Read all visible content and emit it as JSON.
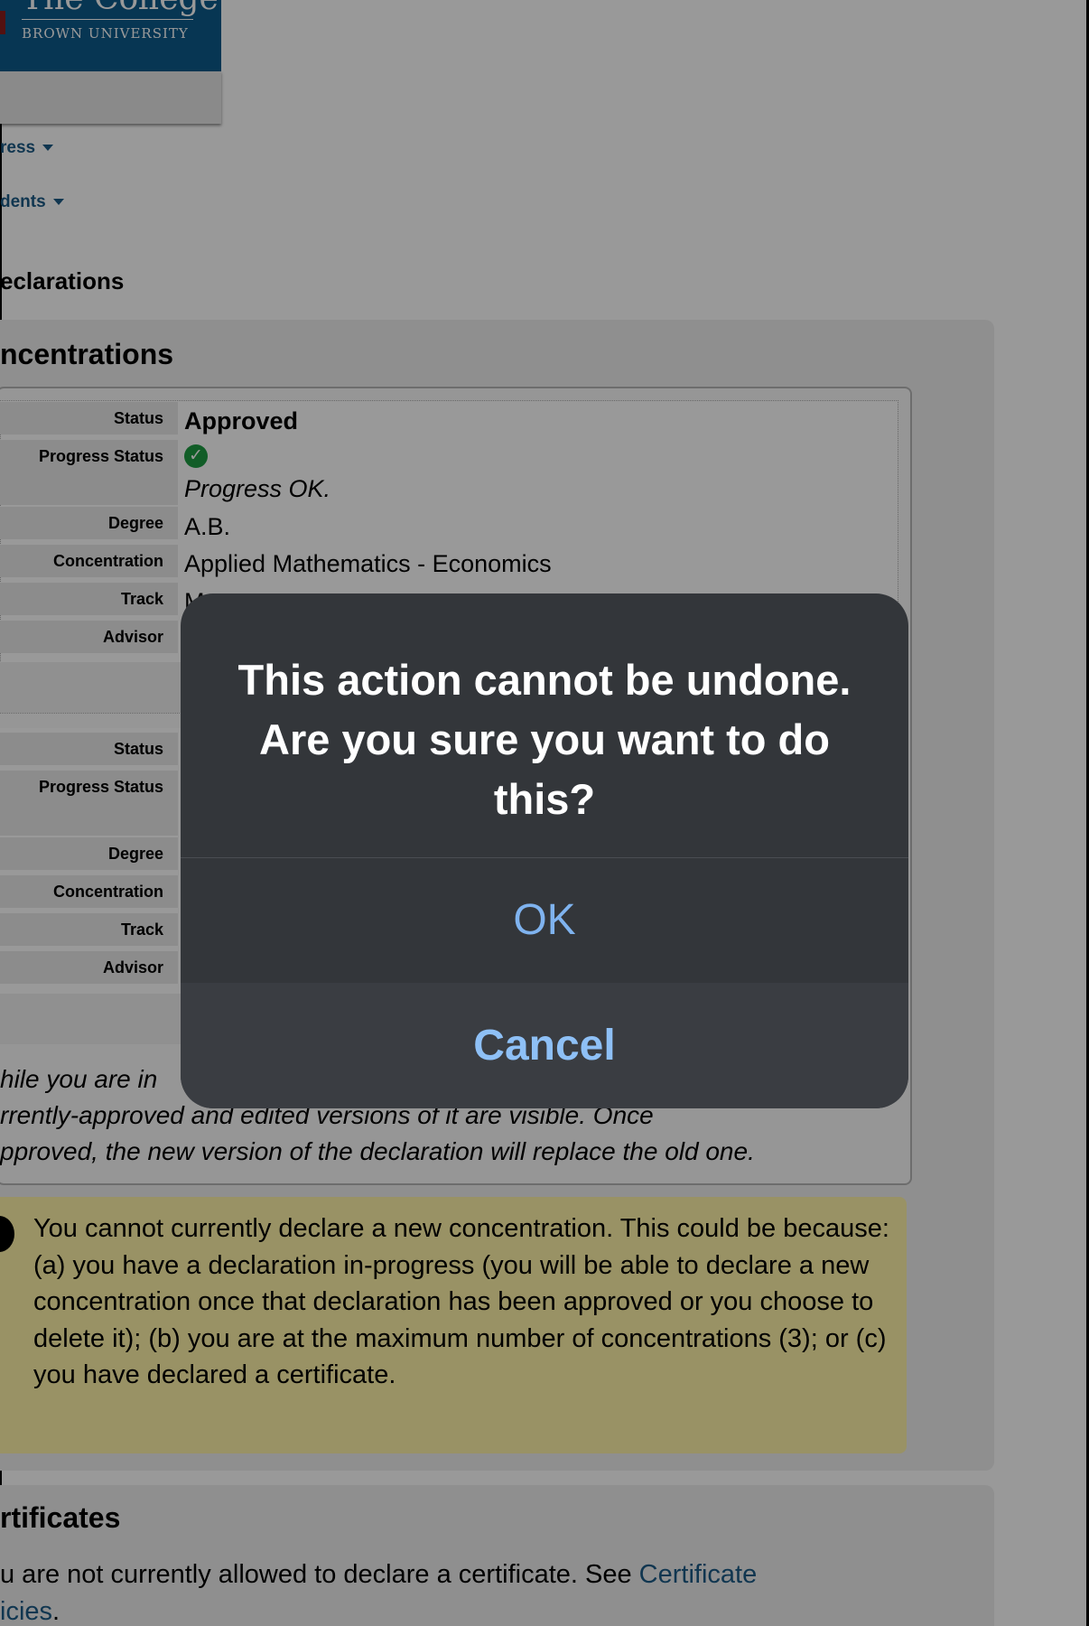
{
  "header": {
    "logo_title": "The College",
    "logo_subtitle": "BROWN UNIVERSITY"
  },
  "nav": {
    "item1": "ress",
    "item2": "dents"
  },
  "section_declarations": "eclarations",
  "section_concentrations": "ncentrations",
  "declaration1": {
    "labels": {
      "status": "Status",
      "progress_status": "Progress Status",
      "degree": "Degree",
      "concentration": "Concentration",
      "track": "Track",
      "advisor": "Advisor"
    },
    "status": "Approved",
    "progress_text": "Progress OK.",
    "degree": "A.B.",
    "concentration": "Applied Mathematics - Economics",
    "track_partial": "M"
  },
  "declaration2": {
    "labels": {
      "status": "Status",
      "progress_status": "Progress Status",
      "degree": "Degree",
      "concentration": "Concentration",
      "track": "Track",
      "advisor": "Advisor"
    }
  },
  "note": {
    "line1": "hile you are in",
    "line2": "rrently-approved and edited versions of it are visible. Once",
    "line3": "pproved, the new version of the declaration will replace the old one."
  },
  "warning": {
    "text": "You cannot currently declare a new concentration. This could be because: (a) you have a declaration in-progress (you will be able to declare a new concentration once that declaration has been approved or you choose to delete it); (b) you are at the maximum number of concentrations (3); or (c) you have declared a certificate."
  },
  "section_certificates": "rtificates",
  "certificates": {
    "text_before": "u are not currently allowed to declare a certificate. See ",
    "link1": "Certificate",
    "link2": "icies",
    "text_after": "."
  },
  "dialog": {
    "message": "This action cannot be undone. Are you sure you want to do this?",
    "ok_label": "OK",
    "cancel_label": "Cancel"
  },
  "colors": {
    "link": "#1c5a86",
    "warning_bg": "#fff3a8",
    "dialog_bg": "#33363a",
    "dialog_button_text": "#7fb3ef",
    "success": "#1d9b41"
  },
  "icons": {
    "progress": "check-circle-icon",
    "warning": "info-icon",
    "dropdown": "caret-down-icon"
  }
}
